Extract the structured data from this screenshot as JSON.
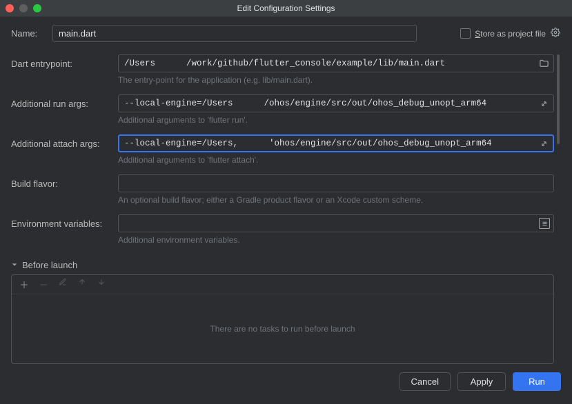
{
  "window": {
    "title": "Edit Configuration Settings"
  },
  "name": {
    "label": "Name:",
    "value": "main.dart"
  },
  "store": {
    "label": "Store as project file",
    "underlined": "S"
  },
  "fields": {
    "entrypoint": {
      "label": "Dart entrypoint:",
      "value": "/Users      /work/github/flutter_console/example/lib/main.dart",
      "help": "The entry-point for the application (e.g. lib/main.dart)."
    },
    "runArgs": {
      "label": "Additional run args:",
      "value": "--local-engine=/Users      /ohos/engine/src/out/ohos_debug_unopt_arm64",
      "help": "Additional arguments to 'flutter run'."
    },
    "attachArgs": {
      "label": "Additional attach args:",
      "value": "--local-engine=/Users,      'ohos/engine/src/out/ohos_debug_unopt_arm64",
      "help": "Additional arguments to 'flutter attach'."
    },
    "buildFlavor": {
      "label": "Build flavor:",
      "value": "",
      "help": "An optional build flavor; either a Gradle product flavor or an Xcode custom scheme."
    },
    "envVars": {
      "label": "Environment variables:",
      "value": "",
      "help": "Additional environment variables."
    }
  },
  "beforeLaunch": {
    "title": "Before launch",
    "empty": "There are no tasks to run before launch"
  },
  "buttons": {
    "cancel": "Cancel",
    "apply": "Apply",
    "run": "Run"
  }
}
